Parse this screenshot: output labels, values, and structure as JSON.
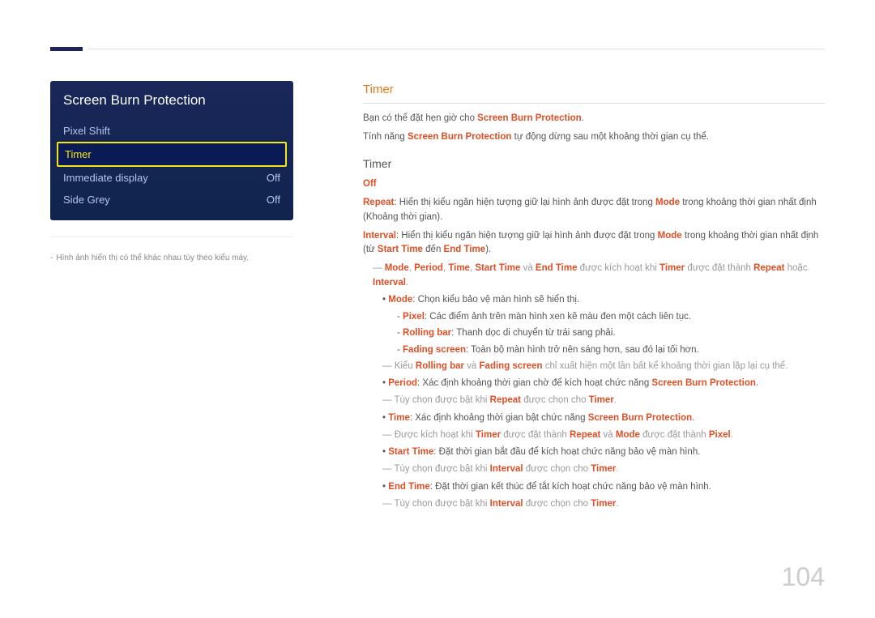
{
  "osd": {
    "title": "Screen Burn Protection",
    "rows": [
      {
        "label": "Pixel Shift",
        "value": ""
      },
      {
        "label": "Timer",
        "value": ""
      },
      {
        "label": "Immediate display",
        "value": "Off"
      },
      {
        "label": "Side Grey",
        "value": "Off"
      }
    ]
  },
  "caption": "Hình ảnh hiển thị có thể khác nhau tùy theo kiểu máy.",
  "sec_title": "Timer",
  "intro1_a": "Bạn có thể đặt hẹn giờ cho ",
  "intro1_b": "Screen Burn Protection",
  "intro1_c": ".",
  "intro2_a": "Tính năng ",
  "intro2_b": "Screen Burn Protection",
  "intro2_c": " tự động dừng sau một khoảng thời gian cụ thể.",
  "sub_title": "Timer",
  "off_label": "Off",
  "repeat_a": "Repeat",
  "repeat_b": ": Hiển thị kiểu ngăn hiện tượng giữ lại hình ảnh được đặt trong ",
  "repeat_c": "Mode",
  "repeat_d": " trong khoảng thời gian nhất định (Khoảng thời gian).",
  "interval_a": "Interval",
  "interval_b": ": Hiển thị kiểu ngăn hiện tượng giữ lại hình ảnh được đặt trong ",
  "interval_c": "Mode",
  "interval_d": " trong khoảng thời gian nhất định (từ ",
  "interval_e": "Start Time",
  "interval_f": " đến ",
  "interval_g": "End Time",
  "interval_h": ").",
  "note1_parts": [
    "Mode",
    ", ",
    "Period",
    ", ",
    "Time",
    ", ",
    "Start Time",
    " và ",
    "End Time",
    " được kích hoạt khi ",
    "Timer",
    " được đặt thành ",
    "Repeat",
    " hoặc ",
    "Interval",
    "."
  ],
  "mode_a": "Mode",
  "mode_b": ": Chọn kiểu bảo vệ màn hình sẽ hiển thị.",
  "pixel_a": "Pixel",
  "pixel_b": ": Các điểm ảnh trên màn hình xen kẽ màu đen một cách liên tục.",
  "rolling_a": "Rolling bar",
  "rolling_b": ": Thanh dọc di chuyển từ trái sang phải.",
  "fading_a": "Fading screen",
  "fading_b": ": Toàn bộ màn hình trở nên sáng hơn, sau đó lại tối hơn.",
  "note2_a": "Kiểu ",
  "note2_b": "Rolling bar",
  "note2_c": " và ",
  "note2_d": "Fading screen",
  "note2_e": " chỉ xuất hiện một lần bất kể khoảng thời gian lặp lại cụ thể.",
  "period_a": "Period",
  "period_b": ": Xác định khoảng thời gian chờ để kích hoạt chức năng ",
  "period_c": "Screen Burn Protection",
  "period_d": ".",
  "note3_a": "Tùy chọn được bật khi ",
  "note3_b": "Repeat",
  "note3_c": " được chọn cho ",
  "note3_d": "Timer",
  "note3_e": ".",
  "time_a": "Time",
  "time_b": ": Xác định khoảng thời gian bật chức năng ",
  "time_c": "Screen Burn Protection",
  "time_d": ".",
  "note4_a": "Được kích hoạt khi ",
  "note4_b": "Timer",
  "note4_c": " được đặt thành ",
  "note4_d": "Repeat",
  "note4_e": " và ",
  "note4_f": "Mode",
  "note4_g": " được đặt thành ",
  "note4_h": "Pixel",
  "note4_i": ".",
  "start_a": "Start Time",
  "start_b": ": Đặt thời gian bắt đầu để kích hoạt chức năng bảo vệ màn hình.",
  "note5_a": "Tùy chọn được bật khi ",
  "note5_b": "Interval",
  "note5_c": " được chọn cho ",
  "note5_d": "Timer",
  "note5_e": ".",
  "end_a": "End Time",
  "end_b": ": Đặt thời gian kết thúc để tắt kích hoạt chức năng bảo vệ màn hình.",
  "note6_a": "Tùy chọn được bật khi ",
  "note6_b": "Interval",
  "note6_c": " được chọn cho ",
  "note6_d": "Timer",
  "note6_e": ".",
  "page_number": "104"
}
